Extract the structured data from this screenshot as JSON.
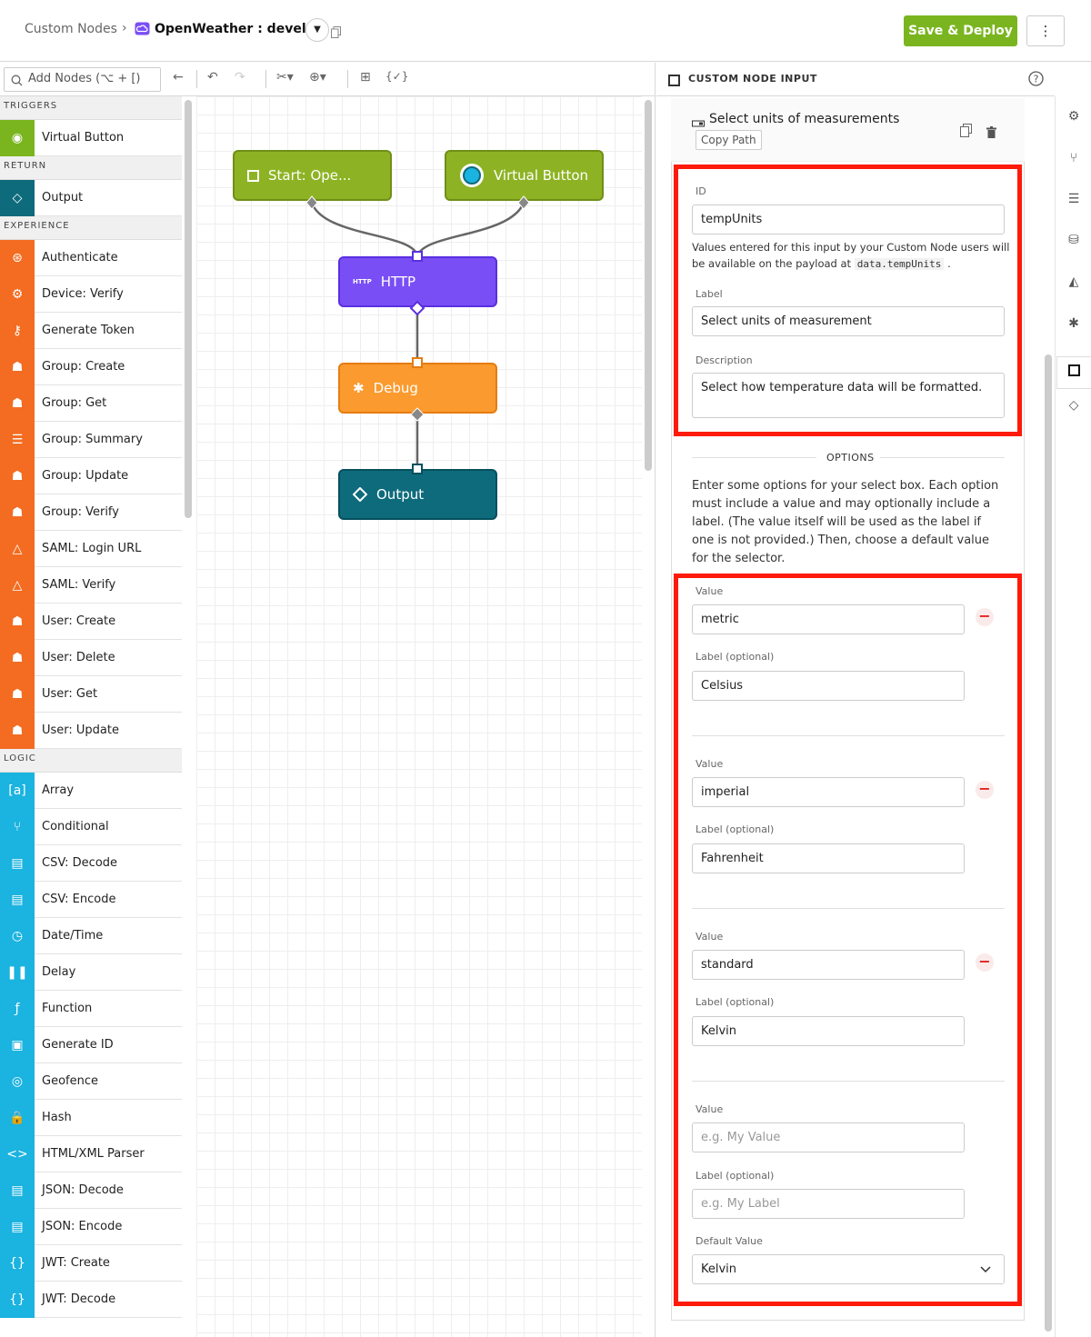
{
  "header": {
    "breadcrumb_root": "Custom Nodes",
    "breadcrumb_sep": "›",
    "node_name": "OpenWeather : develop",
    "save_label": "Save & Deploy",
    "more_label": "⋮"
  },
  "toolbar": {
    "search_placeholder": "Add Nodes (⌥ + [)"
  },
  "palette": {
    "sections": [
      {
        "title": "TRIGGERS",
        "color": "#7ab520",
        "items": [
          "Virtual Button"
        ]
      },
      {
        "title": "RETURN",
        "color": "#0e6b7c",
        "items": [
          "Output"
        ]
      },
      {
        "title": "EXPERIENCE",
        "color": "#f36c21",
        "items": [
          "Authenticate",
          "Device: Verify",
          "Generate Token",
          "Group: Create",
          "Group: Get",
          "Group: Summary",
          "Group: Update",
          "Group: Verify",
          "SAML: Login URL",
          "SAML: Verify",
          "User: Create",
          "User: Delete",
          "User: Get",
          "User: Update"
        ]
      },
      {
        "title": "LOGIC",
        "color": "#1bb3e0",
        "items": [
          "Array",
          "Conditional",
          "CSV: Decode",
          "CSV: Encode",
          "Date/Time",
          "Delay",
          "Function",
          "Generate ID",
          "Geofence",
          "Hash",
          "HTML/XML Parser",
          "JSON: Decode",
          "JSON: Encode",
          "JWT: Create",
          "JWT: Decode"
        ]
      }
    ],
    "icons": {
      "Virtual Button": "◉",
      "Output": "◇",
      "Authenticate": "⊛",
      "Device: Verify": "⚙",
      "Generate Token": "⚷",
      "Group: Create": "☗",
      "Group: Get": "☗",
      "Group: Summary": "☰",
      "Group: Update": "☗",
      "Group: Verify": "☗",
      "SAML: Login URL": "△",
      "SAML: Verify": "△",
      "User: Create": "☗",
      "User: Delete": "☗",
      "User: Get": "☗",
      "User: Update": "☗",
      "Array": "[a]",
      "Conditional": "⑂",
      "CSV: Decode": "▤",
      "CSV: Encode": "▤",
      "Date/Time": "◷",
      "Delay": "❚❚",
      "Function": "ƒ",
      "Generate ID": "▣",
      "Geofence": "◎",
      "Hash": "🔒",
      "HTML/XML Parser": "<>",
      "JSON: Decode": "▤",
      "JSON: Encode": "▤",
      "JWT: Create": "{}",
      "JWT: Decode": "{}"
    }
  },
  "canvas": {
    "nodes": {
      "start": "Start: Ope...",
      "virtual": "Virtual Button",
      "http_tag": "HTTP",
      "http": "HTTP",
      "debug": "Debug",
      "output": "Output"
    },
    "colors": {
      "green": "#8db324",
      "purple": "#7a4ef5",
      "orange": "#fb9a2e",
      "teal": "#0e6b7c"
    }
  },
  "panel": {
    "title": "CUSTOM NODE INPUT",
    "card_title": "Select units of measurements",
    "copy_path": "Copy Path",
    "id_label": "ID",
    "id_value": "tempUnits",
    "id_hint_1": "Values entered for this input by your Custom Node users will",
    "id_hint_2": "be available on the payload at",
    "id_hint_code": "data.tempUnits",
    "id_hint_end": ".",
    "label_label": "Label",
    "label_value": "Select units of measurement",
    "desc_label": "Description",
    "desc_value": "Select how temperature data will be formatted.",
    "options_title": "OPTIONS",
    "options_hint": "Enter some options for your select box. Each option must include a value and may optionally include a label. (The value itself will be used as the label if one is not provided.) Then, choose a default value for the selector.",
    "value_label": "Value",
    "opt_label_label": "Label (optional)",
    "options": [
      {
        "value": "metric",
        "label": "Celsius"
      },
      {
        "value": "imperial",
        "label": "Fahrenheit"
      },
      {
        "value": "standard",
        "label": "Kelvin"
      }
    ],
    "new_value_placeholder": "e.g. My Value",
    "new_label_placeholder": "e.g. My Label",
    "default_label": "Default Value",
    "default_value": "Kelvin"
  }
}
